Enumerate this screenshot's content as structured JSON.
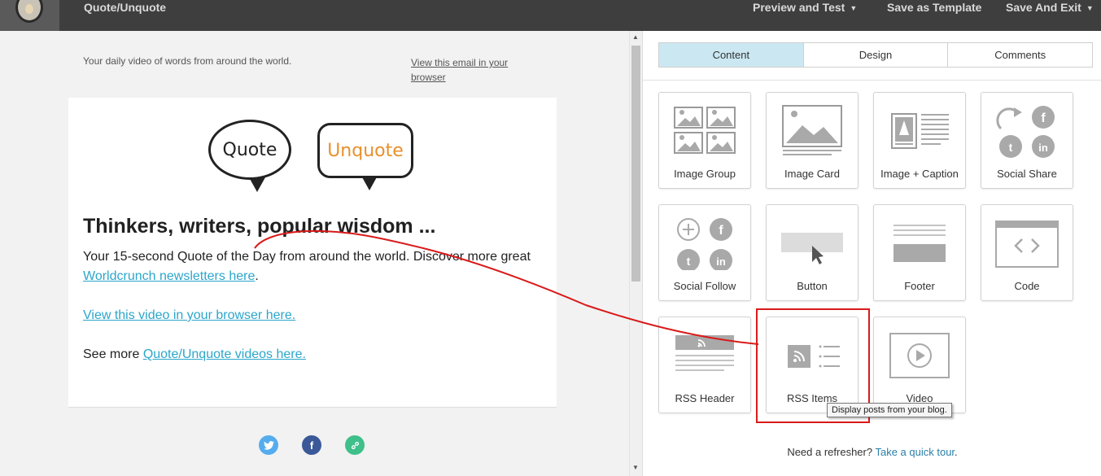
{
  "topbar": {
    "title": "Quote/Unquote",
    "preview_label": "Preview and Test",
    "save_template_label": "Save as Template",
    "save_exit_label": "Save And Exit"
  },
  "email": {
    "preheader": "Your daily video of words from around the world.",
    "view_in_browser": "View this email in your browser",
    "logo_quote": "Quote",
    "logo_unquote": "Unquote",
    "headline": "Thinkers, writers, popular wisdom ...",
    "para1": "Your 15-second Quote of the Day from around the world. Discover more great",
    "para1_link": "Worldcrunch newsletters here",
    "para1_end": ".",
    "video_link": "View this video in your browser here.",
    "see_more_prefix": "See more ",
    "see_more_link": "Quote/Unquote videos here."
  },
  "panel": {
    "tabs": [
      "Content",
      "Design",
      "Comments"
    ],
    "blocks": [
      "Image Group",
      "Image Card",
      "Image + Caption",
      "Social Share",
      "Social Follow",
      "Button",
      "Footer",
      "Code",
      "RSS Header",
      "RSS Items",
      "Video"
    ],
    "tooltip": "Display posts from your blog.",
    "refresher_text": "Need a refresher?",
    "refresher_link": "Take a quick tour",
    "refresher_end": "."
  },
  "colors": {
    "topbar": "#3e3e3e",
    "tab_active": "#cbe8f2",
    "link": "#2ba6cb",
    "unquote_orange": "#e8902b",
    "annotation_red": "#d91a1a",
    "twitter": "#55acee",
    "facebook": "#3b5998",
    "link_icon": "#3fbf8a"
  }
}
